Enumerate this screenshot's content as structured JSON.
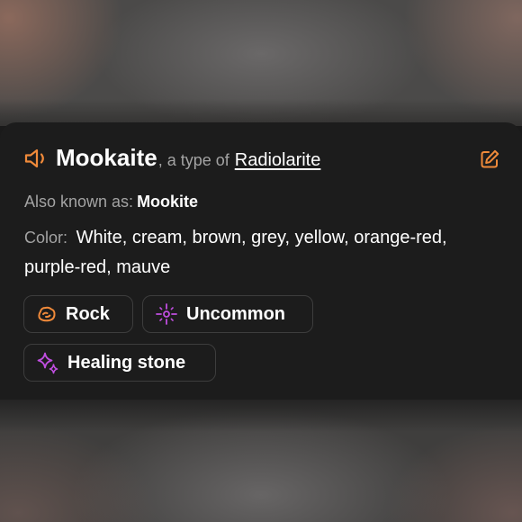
{
  "colors": {
    "accent_orange": "#f08a3a",
    "accent_purple": "#c04ee0",
    "card_background": "#1c1c1c"
  },
  "header": {
    "speaker_icon": "speaker-icon",
    "name": "Mookaite",
    "separator_text": ", a type of",
    "parent_link": "Radiolarite",
    "edit_icon": "edit-icon"
  },
  "details": {
    "also_known_as_label": "Also known as:",
    "also_known_as_value": "Mookite",
    "color_label": "Color:",
    "color_value": "White, cream, brown, grey, yellow, orange-red, purple-red, mauve"
  },
  "tags": [
    {
      "label": "Rock",
      "icon": "rock-icon"
    },
    {
      "label": "Uncommon",
      "icon": "sparkle-target-icon"
    },
    {
      "label": "Healing stone",
      "icon": "sparkles-icon"
    }
  ]
}
